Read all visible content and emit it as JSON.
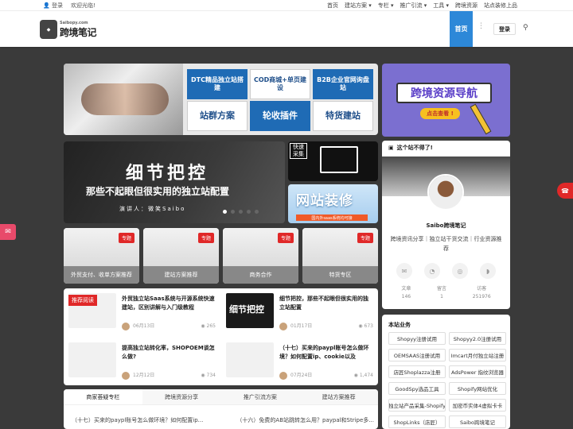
{
  "topbar": {
    "login": "登录",
    "welcome": "欢迎光临!",
    "nav": [
      "首页",
      "建站方案",
      "专栏",
      "推广引流",
      "工具",
      "跨境资源",
      "站点装修上品"
    ]
  },
  "header": {
    "logo_sub": "Saibopy.com",
    "logo_main": "跨境笔记",
    "home": "首页",
    "login": "登录"
  },
  "banner1": {
    "tiles": [
      "DTC精品独立站搭建",
      "COD商城+单页建设",
      "B2B企业官网询盘站",
      "站群方案",
      "轮收插件",
      "特货建站"
    ]
  },
  "banner2": {
    "title": "细节把控",
    "subtitle": "那些不起眼但很实用的独立站配置",
    "speaker": "演讲人：微笑Saibo"
  },
  "banner3": {
    "text": "快速采集"
  },
  "banner4": {
    "title": "网站装修",
    "bar": "国内外saas系统均可接"
  },
  "nav_banner": {
    "title": "跨境资源导航",
    "btn": "点击查看 !"
  },
  "categories": [
    {
      "tag": "专题",
      "label": "外贸支付、收单方案推荐"
    },
    {
      "tag": "专题",
      "label": "建站方案推荐"
    },
    {
      "tag": "专题",
      "label": "商务合作"
    },
    {
      "tag": "专题",
      "label": "特货专区"
    }
  ],
  "posts": [
    {
      "badge": "推荐阅读",
      "title": "外贸独立站Saas系统与开源系统快速建站，区别讲解与入门级教程",
      "date": "06月13日",
      "views": "265"
    },
    {
      "img_text": "细节把控",
      "title": "细节把控，那些不起眼但很实用的独立站配置",
      "date": "01月17日",
      "views": "673"
    },
    {
      "title": "提高独立站转化率，SHOPOEM谈怎么做?",
      "date": "12月12日",
      "views": "734"
    },
    {
      "title": "（十七）买来的paypl账号怎么做环境？如何配置ip、cookie以及",
      "date": "07月24日",
      "views": "1,474"
    }
  ],
  "tabs": [
    "商家荟疑专栏",
    "跨境资源分享",
    "推广引流方案",
    "建站方案推荐"
  ],
  "tab_items": [
    "（十七）买来的paypl账号怎么做环境？如何配置ip...",
    "（十六）免费的AB站跳转怎么用？paypal和Stripe多..."
  ],
  "profile": {
    "head": "这个站不得了!",
    "name": "Saibo跨境笔记",
    "desc": "跨境资讯分享｜独立站干货交流｜行业资源推荐",
    "stats": [
      {
        "label": "文章",
        "value": "146"
      },
      {
        "label": "留言",
        "value": "1"
      },
      {
        "label": "访客",
        "value": "251976"
      }
    ]
  },
  "business": {
    "title": "本站业务",
    "items": [
      "Shopyy注册试用",
      "Shopyy2.0注册试用",
      "OEMSAAS注册试用",
      "Imcart月付独立站注册",
      "店匠Shoplazza注册",
      "AdsPower 指纹浏览器",
      "GoodSpy选品工具",
      "Shopify网站优化",
      "独立站产品采集-Shopify",
      "加密币实体4虚拟卡卡",
      "ShopLinks（店匠）",
      "Saibo跨境笔记"
    ]
  }
}
